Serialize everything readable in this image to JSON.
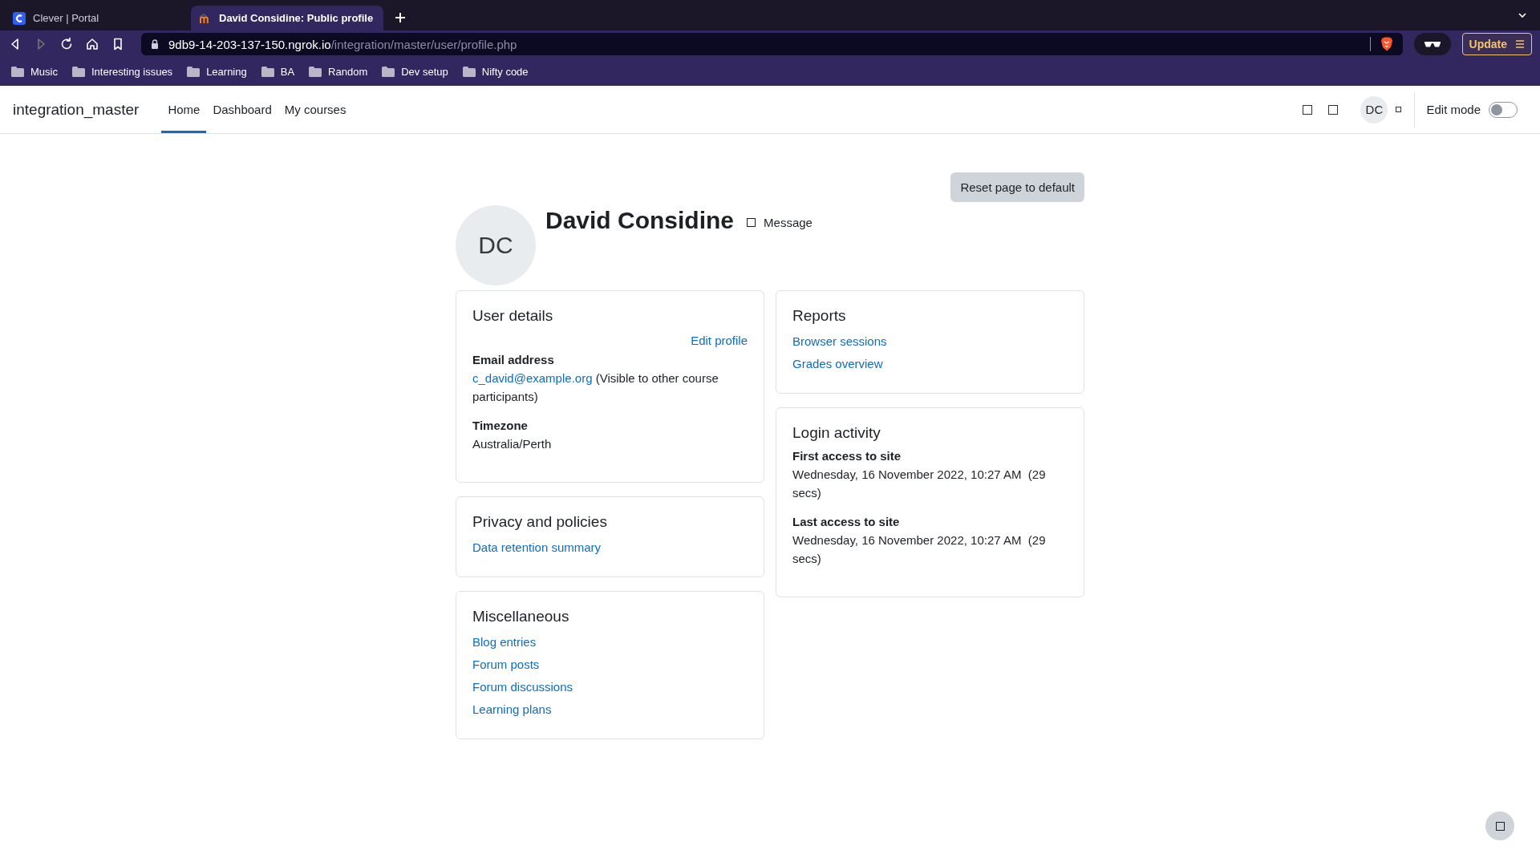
{
  "browser": {
    "tabs": [
      {
        "title": "Clever | Portal",
        "kind": "clever",
        "selected": false
      },
      {
        "title": "David Considine: Public profile",
        "kind": "moodle",
        "selected": true
      }
    ],
    "address": {
      "host": "9db9-14-203-137-150.ngrok.io",
      "path": "/integration/master/user/profile.php"
    },
    "update_button": "Update",
    "bookmarks": [
      "Music",
      "Interesting issues",
      "Learning",
      "BA",
      "Random",
      "Dev setup",
      "Nifty code"
    ]
  },
  "navbar": {
    "site_name": "integration_master",
    "nav": [
      {
        "label": "Home",
        "selected": true
      },
      {
        "label": "Dashboard",
        "selected": false
      },
      {
        "label": "My courses",
        "selected": false
      }
    ],
    "avatar_initials": "DC",
    "edit_mode": {
      "label": "Edit mode",
      "on": false
    }
  },
  "page": {
    "reset_button": "Reset page to default",
    "profile": {
      "initials": "DC",
      "name": "David Considine",
      "message_label": "Message"
    },
    "columns": [
      [
        {
          "title": "User details",
          "items": [
            {
              "kind": "action",
              "text": "Edit profile"
            },
            {
              "kind": "field",
              "label": "Email address",
              "link": "c_david@example.org",
              "text": " (Visible to other course participants)"
            },
            {
              "kind": "field",
              "label": "Timezone",
              "text": "Australia/Perth"
            }
          ]
        },
        {
          "title": "Privacy and policies",
          "items": [
            {
              "kind": "link",
              "text": "Data retention summary"
            }
          ]
        },
        {
          "title": "Miscellaneous",
          "items": [
            {
              "kind": "link",
              "text": "Blog entries"
            },
            {
              "kind": "link",
              "text": "Forum posts"
            },
            {
              "kind": "link",
              "text": "Forum discussions"
            },
            {
              "kind": "link",
              "text": "Learning plans"
            }
          ]
        }
      ],
      [
        {
          "title": "Reports",
          "items": [
            {
              "kind": "link",
              "text": "Browser sessions"
            },
            {
              "kind": "link",
              "text": "Grades overview"
            }
          ]
        },
        {
          "title": "Login activity",
          "items": [
            {
              "kind": "field",
              "label": "First access to site",
              "text": "Wednesday, 16 November 2022, 10:27 AM  (29 secs)"
            },
            {
              "kind": "field",
              "label": "Last access to site",
              "text": "Wednesday, 16 November 2022, 10:27 AM  (29 secs)"
            }
          ]
        }
      ]
    ]
  }
}
